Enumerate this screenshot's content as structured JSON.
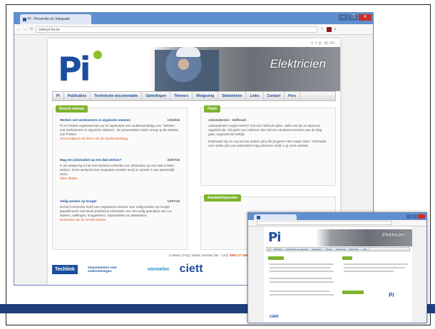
{
  "browser": {
    "tab_title": "Pi - Preventie en Integratie",
    "url": "www.pi-bs.be",
    "window_controls": [
      "–",
      "❐",
      "✕"
    ]
  },
  "site": {
    "logo": "Pi",
    "banner_title": "Elektricien",
    "nav": [
      "Pi",
      "Publicaties",
      "Technische documentatie",
      "Opleidingen",
      "Thema's",
      "Wetgeving",
      "Statistieken",
      "Links",
      "Contact",
      "Pers"
    ],
    "recent_title": "Recent nieuws",
    "news": [
      {
        "title": "Werken met werknemers in atypische statuten",
        "date": "13/10/15",
        "text": "Pi en Prebes organiseerden op 24 september een studienamiddag over \"Werken met werknemers in atypische statuten\". De presentaties vindt u terug op de website van Prebes.",
        "link": "Het verslag en de foto's van de studienamiddag"
      },
      {
        "title": "Mag een jobstudent op een dak werken?",
        "date": "20/07/15",
        "text": "In de wetgeving is het met expliciet verboden een jobstudent op een dak te laten werken. Deze werkpost kan toegelaten worden tenzij er sprake is van aanzienlijk risico.",
        "link": "Meer details"
      },
      {
        "title": "Veilig werken op hoogte",
        "date": "13/07/15",
        "text": "NAVB Constructiv heeft een nagelnieuw dossier over veilig werken op hoogte gepubliceerd. Het bevat praktische informatie over het veilig gebruiken van o.a. ladders, stellingen, hoogwerkers, hijsmiddelen en dakwerken.",
        "link": "Download van de NAVB website"
      }
    ],
    "flash_title": "Flash",
    "flash_heading": "Jobstudenten - Helftruck",
    "flash_text": "Jobstudenten mogen NOOIT met een heftruck rijden. Zelfs niet als ze daarvoor opgeleid zijn. Dit geldt voor iedereen die met een studentencontract aan de slag gaat, ongeacht de leeftijd.",
    "flash_text2": "Daarnaast zijn er nog tal van andere jobs die jongeren niet mogen doen. Informatie over welke jobs een jobstudent mag uitvoeren vindt u op onze website.",
    "aandacht_title": "Aandachtspunten",
    "contact_label": "Contact | FAQ | Gratis nummer (8u - 17u):",
    "contact_number": "0800 27 048",
    "footer_logos": [
      "Techlink",
      "Samenwerken voor ondernemingen",
      "vormelec",
      "ciett"
    ]
  },
  "second_window": {
    "logo": "Pi",
    "banner_title": "Elektricien"
  }
}
